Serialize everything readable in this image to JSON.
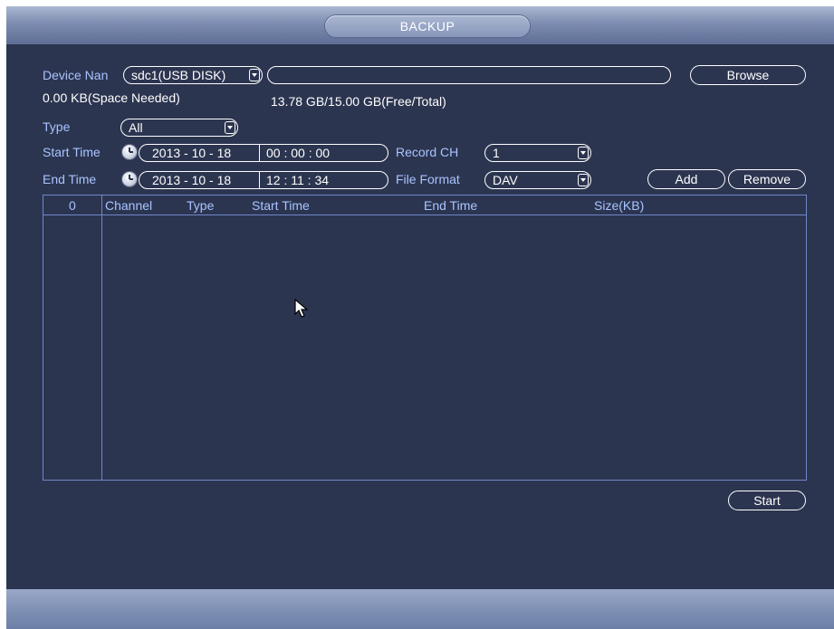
{
  "window": {
    "title": "BACKUP"
  },
  "device": {
    "label": "Device Nan",
    "value": "sdc1(USB DISK)",
    "path_value": "",
    "browse_label": "Browse"
  },
  "space": {
    "needed": "0.00 KB(Space Needed)",
    "free_total": "13.78 GB/15.00 GB(Free/Total)"
  },
  "type": {
    "label": "Type",
    "value": "All"
  },
  "start_time": {
    "label": "Start Time",
    "date": "2013 - 10 - 18",
    "time": "00 : 00 : 00"
  },
  "end_time": {
    "label": "End Time",
    "date": "2013 - 10 - 18",
    "time": "12 : 11 : 34"
  },
  "record_ch": {
    "label": "Record CH",
    "value": "1"
  },
  "file_format": {
    "label": "File Format",
    "value": "DAV"
  },
  "buttons": {
    "add": "Add",
    "remove": "Remove",
    "start": "Start"
  },
  "table": {
    "count": "0",
    "columns": [
      "Channel",
      "Type",
      "Start Time",
      "End Time",
      "Size(KB)"
    ],
    "rows": []
  },
  "icons": {
    "clock": "clock-icon",
    "dropdown": "chevron-down-icon",
    "cursor": "mouse-pointer-icon"
  },
  "colors": {
    "background": "#2c3550",
    "label": "#a8c4ff",
    "border": "#6f86c8",
    "text": "#ffffff"
  }
}
